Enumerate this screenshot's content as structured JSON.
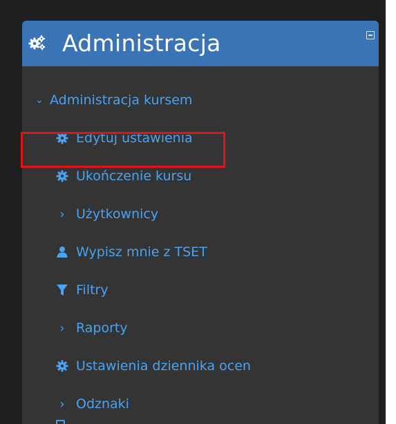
{
  "block": {
    "title": "Administracja",
    "header_icon": "cogs-icon",
    "collapse_icon": "minus-square-icon"
  },
  "nav": {
    "section_label": "Administracja kursem",
    "items": [
      {
        "label": "Edytuj ustawienia",
        "icon": "gear-icon"
      },
      {
        "label": "Ukończenie kursu",
        "icon": "gear-icon"
      },
      {
        "label": "Użytkownicy",
        "icon": "chevron-right-icon"
      },
      {
        "label": "Wypisz mnie z TSET",
        "icon": "user-icon"
      },
      {
        "label": "Filtry",
        "icon": "filter-icon"
      },
      {
        "label": "Raporty",
        "icon": "chevron-right-icon"
      },
      {
        "label": "Ustawienia dziennika ocen",
        "icon": "gear-icon"
      },
      {
        "label": "Odznaki",
        "icon": "chevron-right-icon"
      }
    ]
  },
  "colors": {
    "header_bg": "#3b73b7",
    "link": "#4aa3f0",
    "panel_bg": "#343434",
    "highlight": "#e0141b"
  }
}
